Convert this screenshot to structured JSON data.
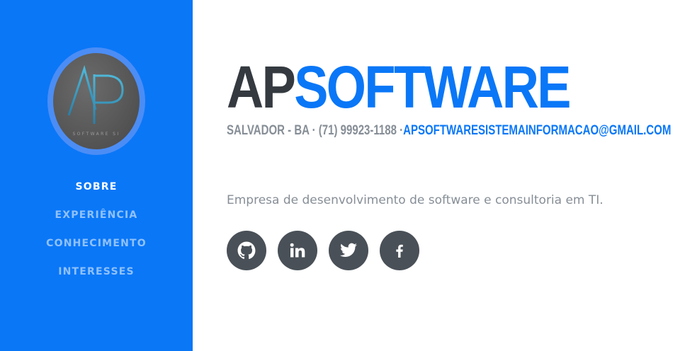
{
  "sidebar": {
    "logo": {
      "letters": "AP",
      "tagline": "SOFTWARE SI"
    },
    "nav": [
      {
        "label": "SOBRE",
        "active": true
      },
      {
        "label": "EXPERIÊNCIA",
        "active": false
      },
      {
        "label": "CONHECIMENTO",
        "active": false
      },
      {
        "label": "INTERESSES",
        "active": false
      }
    ]
  },
  "header": {
    "brand_part1": "AP",
    "brand_part2": "SOFTWARE",
    "location": "SALVADOR - BA · (71) 99923-1188 ·",
    "email": "APSOFTWARESISTEMAINFORMACAO@GMAIL.COM"
  },
  "about": {
    "text": "Empresa de desenvolvimento de software e consultoria em TI."
  },
  "social": [
    {
      "name": "github",
      "icon": "github-icon"
    },
    {
      "name": "linkedin",
      "icon": "linkedin-icon"
    },
    {
      "name": "twitter",
      "icon": "twitter-icon"
    },
    {
      "name": "facebook",
      "icon": "facebook-icon"
    }
  ],
  "colors": {
    "primary": "#0a77f7",
    "dark": "#343a40",
    "muted": "#868e96",
    "social_bg": "#495057"
  }
}
